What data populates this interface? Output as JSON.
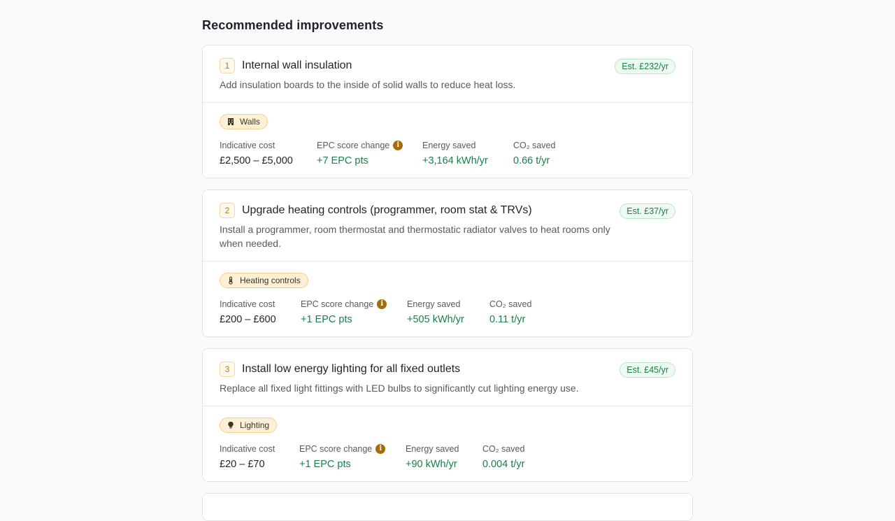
{
  "section_title": "Recommended improvements",
  "labels": {
    "cost": "Indicative cost",
    "epc": "EPC score change",
    "energy": "Energy saved",
    "co2": "CO₂ saved"
  },
  "colors": {
    "accent_green": "#1a7f47",
    "tag_bg": "#fdf0d5",
    "info_icon": "#a86a07"
  },
  "recommendations": [
    {
      "number": "1",
      "title": "Internal wall insulation",
      "description": "Add insulation boards to the inside of solid walls to reduce heat loss.",
      "estimate": "Est. £232/yr",
      "category": "Walls",
      "category_icon": "wall-icon",
      "cost": "£2,500 – £5,000",
      "epc_change": "+7 EPC pts",
      "energy_saved": "+3,164 kWh/yr",
      "co2_saved": "0.66 t/yr"
    },
    {
      "number": "2",
      "title": "Upgrade heating controls (programmer, room stat & TRVs)",
      "description": "Install a programmer, room thermostat and thermostatic radiator valves to heat rooms only when needed.",
      "estimate": "Est. £37/yr",
      "category": "Heating controls",
      "category_icon": "thermometer-icon",
      "cost": "£200 – £600",
      "epc_change": "+1 EPC pts",
      "energy_saved": "+505 kWh/yr",
      "co2_saved": "0.11 t/yr"
    },
    {
      "number": "3",
      "title": "Install low energy lighting for all fixed outlets",
      "description": "Replace all fixed light fittings with LED bulbs to significantly cut lighting energy use.",
      "estimate": "Est. £45/yr",
      "category": "Lighting",
      "category_icon": "lightbulb-icon",
      "cost": "£20 – £70",
      "epc_change": "+1 EPC pts",
      "energy_saved": "+90 kWh/yr",
      "co2_saved": "0.004 t/yr"
    }
  ]
}
